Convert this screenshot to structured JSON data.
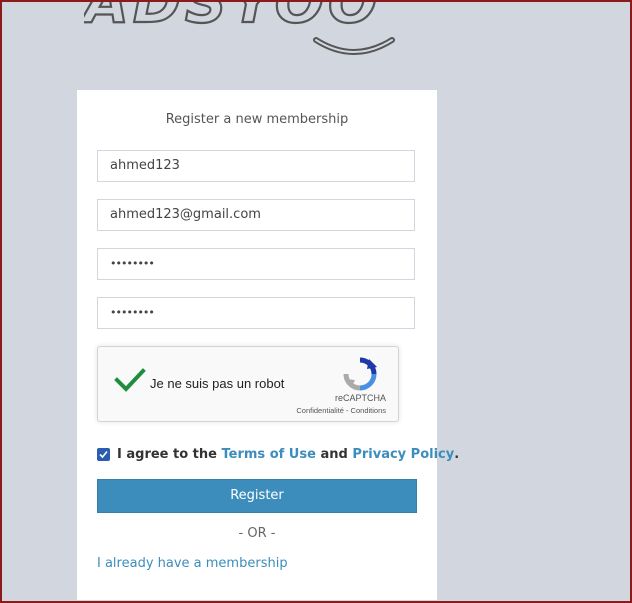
{
  "logo": {
    "text": "ADSYOO"
  },
  "form": {
    "title": "Register a new membership",
    "username_value": "ahmed123",
    "email_value": "ahmed123@gmail.com",
    "password_value": "••••••••",
    "retype_password_value": "••••••••"
  },
  "captcha": {
    "label": "Je ne suis pas un robot",
    "brand": "reCAPTCHA",
    "terms": "Confidentialité - Conditions",
    "checked": true
  },
  "agree": {
    "prefix": "I agree to the",
    "terms_link": "Terms of Use",
    "middle": "and",
    "privacy_link": "Privacy Policy",
    "suffix": ".",
    "checked": true
  },
  "register_button": "Register",
  "or_divider": "- OR -",
  "already_member_link": "I already have a membership",
  "colors": {
    "background": "#d2d6de",
    "accent": "#3c8dbc",
    "frame_border": "#8b1a1a",
    "captcha_check": "#1e8e3e"
  }
}
